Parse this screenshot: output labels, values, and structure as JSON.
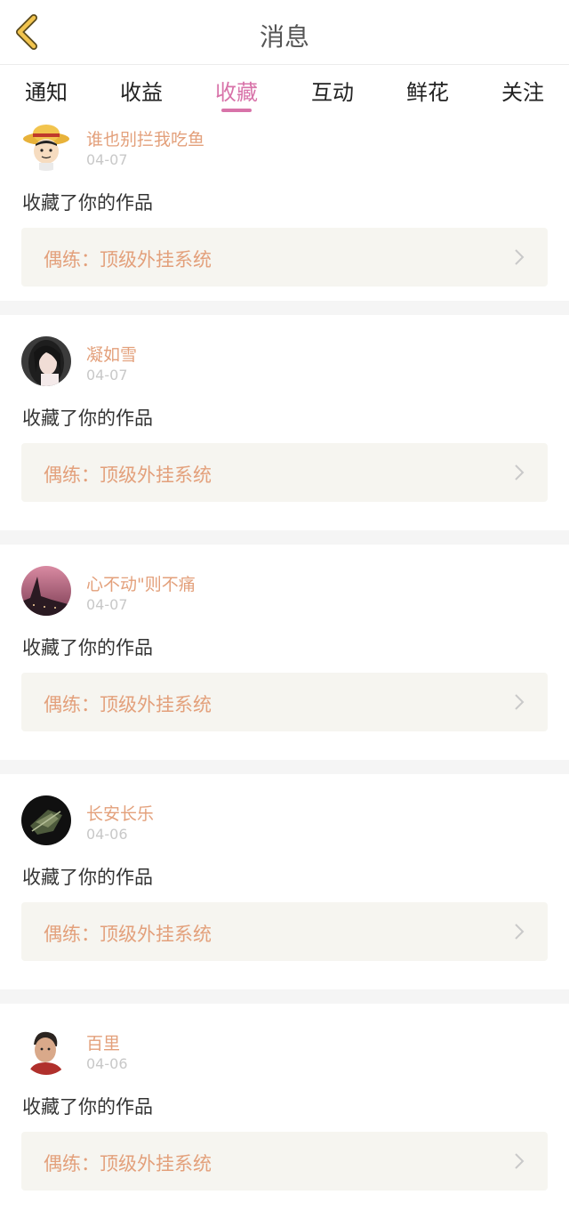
{
  "header": {
    "title": "消息"
  },
  "tabs": [
    {
      "label": "通知"
    },
    {
      "label": "收益"
    },
    {
      "label": "收藏"
    },
    {
      "label": "互动"
    },
    {
      "label": "鲜花"
    },
    {
      "label": "关注"
    }
  ],
  "active_tab": "收藏",
  "messages": [
    {
      "user": "谁也别拦我吃鱼",
      "date": "04-07",
      "action": "收藏了你的作品",
      "work_title": "偶练：顶级外挂系统"
    },
    {
      "user": "凝如雪",
      "date": "04-07",
      "action": "收藏了你的作品",
      "work_title": "偶练：顶级外挂系统"
    },
    {
      "user": "心不动\"则不痛",
      "date": "04-07",
      "action": "收藏了你的作品",
      "work_title": "偶练：顶级外挂系统"
    },
    {
      "user": "长安长乐",
      "date": "04-06",
      "action": "收藏了你的作品",
      "work_title": "偶练：顶级外挂系统"
    },
    {
      "user": "百里",
      "date": "04-06",
      "action": "收藏了你的作品",
      "work_title": "偶练：顶级外挂系统"
    }
  ],
  "colors": {
    "accent": "#d873a9",
    "username": "#e3a07b",
    "back_arrow": "#f2c44e"
  }
}
